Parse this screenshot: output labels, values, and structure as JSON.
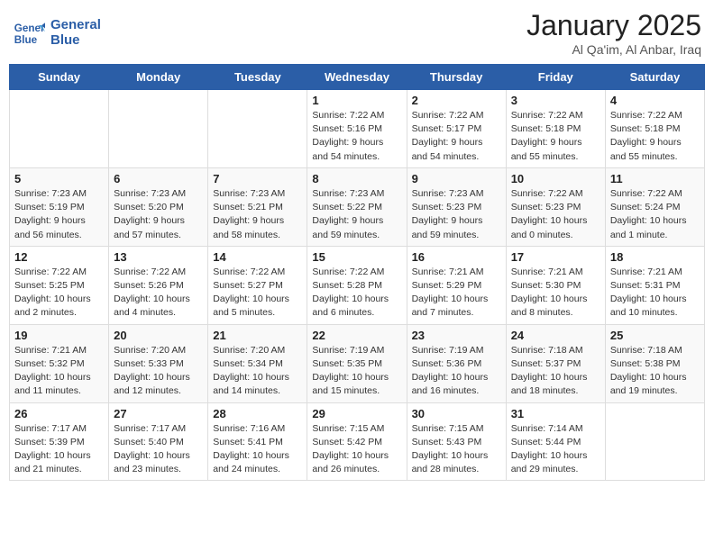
{
  "header": {
    "logo_line1": "General",
    "logo_line2": "Blue",
    "month_title": "January 2025",
    "location": "Al Qa'im, Al Anbar, Iraq"
  },
  "weekdays": [
    "Sunday",
    "Monday",
    "Tuesday",
    "Wednesday",
    "Thursday",
    "Friday",
    "Saturday"
  ],
  "weeks": [
    [
      {
        "day": null,
        "sunrise": null,
        "sunset": null,
        "daylight": null
      },
      {
        "day": null,
        "sunrise": null,
        "sunset": null,
        "daylight": null
      },
      {
        "day": null,
        "sunrise": null,
        "sunset": null,
        "daylight": null
      },
      {
        "day": "1",
        "sunrise": "Sunrise: 7:22 AM",
        "sunset": "Sunset: 5:16 PM",
        "daylight": "Daylight: 9 hours and 54 minutes."
      },
      {
        "day": "2",
        "sunrise": "Sunrise: 7:22 AM",
        "sunset": "Sunset: 5:17 PM",
        "daylight": "Daylight: 9 hours and 54 minutes."
      },
      {
        "day": "3",
        "sunrise": "Sunrise: 7:22 AM",
        "sunset": "Sunset: 5:18 PM",
        "daylight": "Daylight: 9 hours and 55 minutes."
      },
      {
        "day": "4",
        "sunrise": "Sunrise: 7:22 AM",
        "sunset": "Sunset: 5:18 PM",
        "daylight": "Daylight: 9 hours and 55 minutes."
      }
    ],
    [
      {
        "day": "5",
        "sunrise": "Sunrise: 7:23 AM",
        "sunset": "Sunset: 5:19 PM",
        "daylight": "Daylight: 9 hours and 56 minutes."
      },
      {
        "day": "6",
        "sunrise": "Sunrise: 7:23 AM",
        "sunset": "Sunset: 5:20 PM",
        "daylight": "Daylight: 9 hours and 57 minutes."
      },
      {
        "day": "7",
        "sunrise": "Sunrise: 7:23 AM",
        "sunset": "Sunset: 5:21 PM",
        "daylight": "Daylight: 9 hours and 58 minutes."
      },
      {
        "day": "8",
        "sunrise": "Sunrise: 7:23 AM",
        "sunset": "Sunset: 5:22 PM",
        "daylight": "Daylight: 9 hours and 59 minutes."
      },
      {
        "day": "9",
        "sunrise": "Sunrise: 7:23 AM",
        "sunset": "Sunset: 5:23 PM",
        "daylight": "Daylight: 9 hours and 59 minutes."
      },
      {
        "day": "10",
        "sunrise": "Sunrise: 7:22 AM",
        "sunset": "Sunset: 5:23 PM",
        "daylight": "Daylight: 10 hours and 0 minutes."
      },
      {
        "day": "11",
        "sunrise": "Sunrise: 7:22 AM",
        "sunset": "Sunset: 5:24 PM",
        "daylight": "Daylight: 10 hours and 1 minute."
      }
    ],
    [
      {
        "day": "12",
        "sunrise": "Sunrise: 7:22 AM",
        "sunset": "Sunset: 5:25 PM",
        "daylight": "Daylight: 10 hours and 2 minutes."
      },
      {
        "day": "13",
        "sunrise": "Sunrise: 7:22 AM",
        "sunset": "Sunset: 5:26 PM",
        "daylight": "Daylight: 10 hours and 4 minutes."
      },
      {
        "day": "14",
        "sunrise": "Sunrise: 7:22 AM",
        "sunset": "Sunset: 5:27 PM",
        "daylight": "Daylight: 10 hours and 5 minutes."
      },
      {
        "day": "15",
        "sunrise": "Sunrise: 7:22 AM",
        "sunset": "Sunset: 5:28 PM",
        "daylight": "Daylight: 10 hours and 6 minutes."
      },
      {
        "day": "16",
        "sunrise": "Sunrise: 7:21 AM",
        "sunset": "Sunset: 5:29 PM",
        "daylight": "Daylight: 10 hours and 7 minutes."
      },
      {
        "day": "17",
        "sunrise": "Sunrise: 7:21 AM",
        "sunset": "Sunset: 5:30 PM",
        "daylight": "Daylight: 10 hours and 8 minutes."
      },
      {
        "day": "18",
        "sunrise": "Sunrise: 7:21 AM",
        "sunset": "Sunset: 5:31 PM",
        "daylight": "Daylight: 10 hours and 10 minutes."
      }
    ],
    [
      {
        "day": "19",
        "sunrise": "Sunrise: 7:21 AM",
        "sunset": "Sunset: 5:32 PM",
        "daylight": "Daylight: 10 hours and 11 minutes."
      },
      {
        "day": "20",
        "sunrise": "Sunrise: 7:20 AM",
        "sunset": "Sunset: 5:33 PM",
        "daylight": "Daylight: 10 hours and 12 minutes."
      },
      {
        "day": "21",
        "sunrise": "Sunrise: 7:20 AM",
        "sunset": "Sunset: 5:34 PM",
        "daylight": "Daylight: 10 hours and 14 minutes."
      },
      {
        "day": "22",
        "sunrise": "Sunrise: 7:19 AM",
        "sunset": "Sunset: 5:35 PM",
        "daylight": "Daylight: 10 hours and 15 minutes."
      },
      {
        "day": "23",
        "sunrise": "Sunrise: 7:19 AM",
        "sunset": "Sunset: 5:36 PM",
        "daylight": "Daylight: 10 hours and 16 minutes."
      },
      {
        "day": "24",
        "sunrise": "Sunrise: 7:18 AM",
        "sunset": "Sunset: 5:37 PM",
        "daylight": "Daylight: 10 hours and 18 minutes."
      },
      {
        "day": "25",
        "sunrise": "Sunrise: 7:18 AM",
        "sunset": "Sunset: 5:38 PM",
        "daylight": "Daylight: 10 hours and 19 minutes."
      }
    ],
    [
      {
        "day": "26",
        "sunrise": "Sunrise: 7:17 AM",
        "sunset": "Sunset: 5:39 PM",
        "daylight": "Daylight: 10 hours and 21 minutes."
      },
      {
        "day": "27",
        "sunrise": "Sunrise: 7:17 AM",
        "sunset": "Sunset: 5:40 PM",
        "daylight": "Daylight: 10 hours and 23 minutes."
      },
      {
        "day": "28",
        "sunrise": "Sunrise: 7:16 AM",
        "sunset": "Sunset: 5:41 PM",
        "daylight": "Daylight: 10 hours and 24 minutes."
      },
      {
        "day": "29",
        "sunrise": "Sunrise: 7:15 AM",
        "sunset": "Sunset: 5:42 PM",
        "daylight": "Daylight: 10 hours and 26 minutes."
      },
      {
        "day": "30",
        "sunrise": "Sunrise: 7:15 AM",
        "sunset": "Sunset: 5:43 PM",
        "daylight": "Daylight: 10 hours and 28 minutes."
      },
      {
        "day": "31",
        "sunrise": "Sunrise: 7:14 AM",
        "sunset": "Sunset: 5:44 PM",
        "daylight": "Daylight: 10 hours and 29 minutes."
      },
      {
        "day": null,
        "sunrise": null,
        "sunset": null,
        "daylight": null
      }
    ]
  ]
}
